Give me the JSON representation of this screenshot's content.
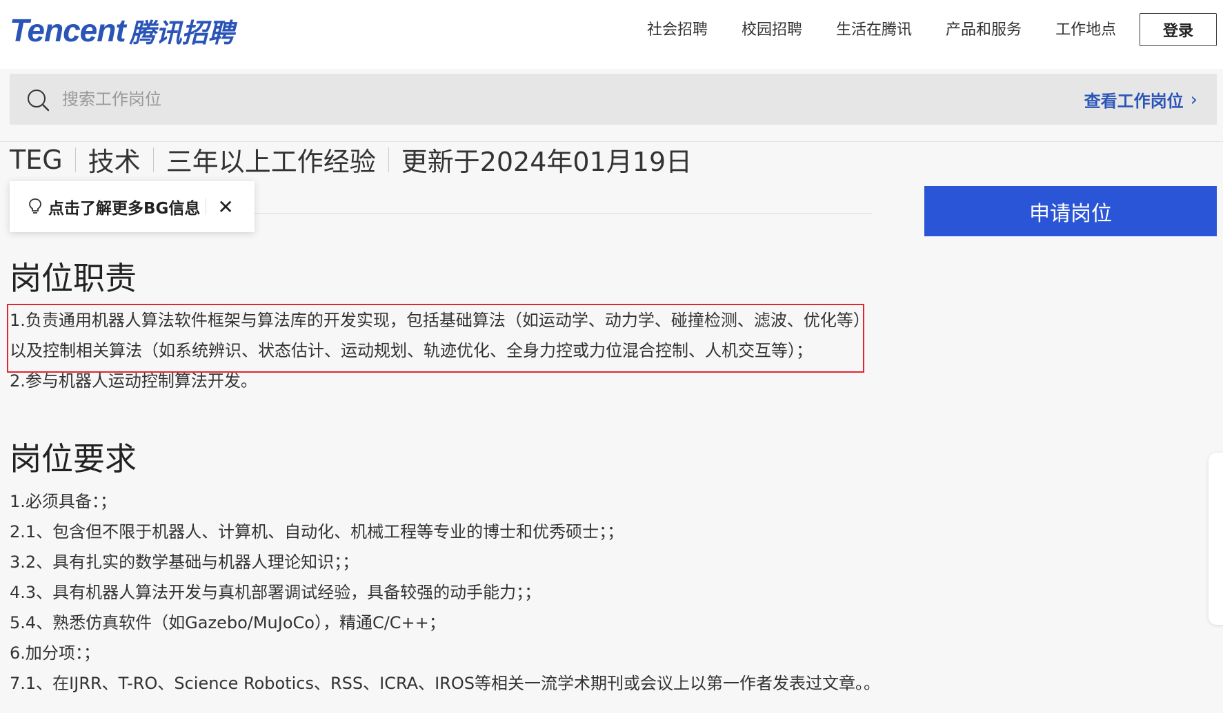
{
  "header": {
    "logo_brand": "Tencent",
    "logo_cn": "腾讯招聘",
    "nav": [
      {
        "label": "社会招聘"
      },
      {
        "label": "校园招聘"
      },
      {
        "label": "生活在腾讯"
      },
      {
        "label": "产品和服务"
      },
      {
        "label": "工作地点"
      }
    ],
    "login_label": "登录"
  },
  "search": {
    "placeholder": "搜索工作岗位",
    "view_jobs_label": "查看工作岗位",
    "view_jobs_chevron": "›"
  },
  "job_meta": {
    "bg": "TEG",
    "category": "技术",
    "experience": "三年以上工作经验",
    "updated": "更新于2024年01月19日"
  },
  "bg_tip": {
    "text": "点击了解更多BG信息",
    "close": "✕"
  },
  "apply_label": "申请岗位",
  "duties": {
    "title": "岗位职责",
    "items": [
      "1.负责通用机器人算法软件框架与算法库的开发实现，包括基础算法（如运动学、动力学、碰撞检测、滤波、优化等）以及控制相关算法（如系统辨识、状态估计、运动规划、轨迹优化、全身力控或力位混合控制、人机交互等）；",
      "2.参与机器人运动控制算法开发。"
    ]
  },
  "requirements": {
    "title": "岗位要求",
    "items": [
      "1.必须具备：；",
      "2.1、包含但不限于机器人、计算机、自动化、机械工程等专业的博士和优秀硕士；；",
      "3.2、具有扎实的数学基础与机器人理论知识；；",
      "4.3、具有机器人算法开发与真机部署调试经验，具备较强的动手能力；；",
      "5.4、熟悉仿真软件（如Gazebo/MuJoCo），精通C/C++；",
      "6.加分项：；",
      "7.1、在IJRR、T-RO、Science Robotics、RSS、ICRA、IROS等相关一流学术期刊或会议上以第一作者发表过文章。。"
    ]
  },
  "colors": {
    "brand_blue": "#2a55b7",
    "apply_blue": "#2a55d6",
    "highlight_red": "#e0262e"
  }
}
